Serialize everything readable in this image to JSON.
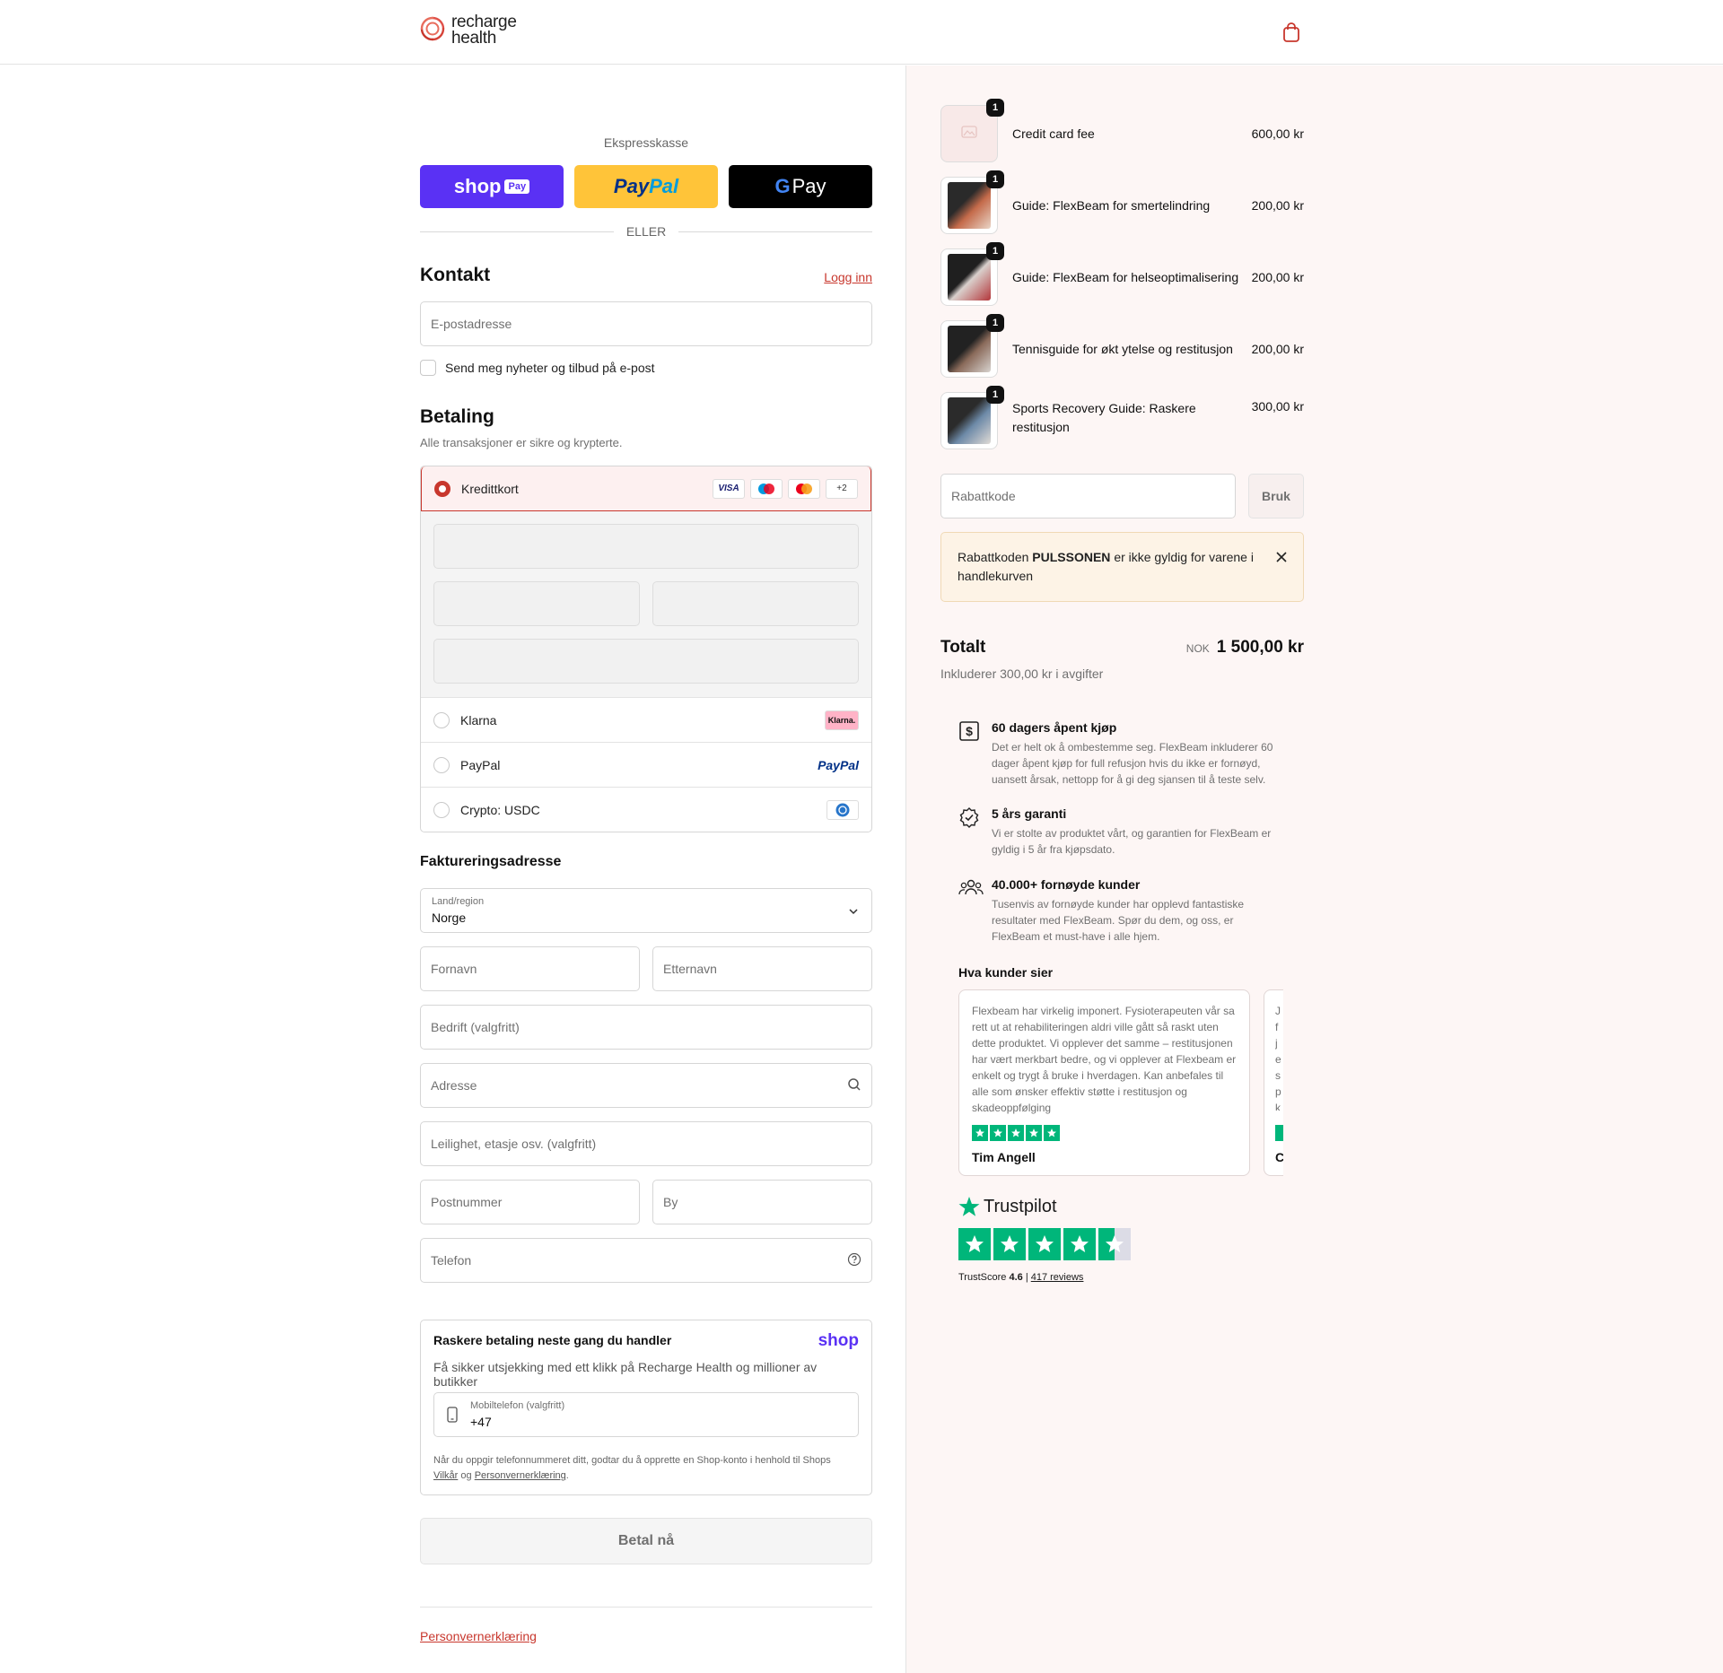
{
  "header": {
    "brand_line1": "recharge",
    "brand_line2": "health",
    "cart_icon": "bag-icon"
  },
  "express": {
    "title": "Ekspresskasse",
    "shop_label": "shop",
    "shop_badge": "Pay",
    "paypal_part1": "Pay",
    "paypal_part2": "Pal",
    "gpay_g": "G",
    "gpay_label": "Pay",
    "or_label": "ELLER"
  },
  "contact": {
    "title": "Kontakt",
    "login_link": "Logg inn",
    "email_placeholder": "E-postadresse",
    "newsletter_label": "Send meg nyheter og tilbud på e-post"
  },
  "payment": {
    "title": "Betaling",
    "subtitle": "Alle transaksjoner er sikre og krypterte.",
    "options": [
      {
        "label": "Kredittkort",
        "selected": true
      },
      {
        "label": "Klarna",
        "selected": false,
        "badge": "Klarna."
      },
      {
        "label": "PayPal",
        "selected": false,
        "badge": "PayPal"
      },
      {
        "label": "Crypto: USDC",
        "selected": false
      }
    ],
    "card_brands": [
      "VISA",
      "+2"
    ]
  },
  "billing": {
    "title": "Faktureringsadresse",
    "country_label": "Land/region",
    "country_value": "Norge",
    "first_name": "Fornavn",
    "last_name": "Etternavn",
    "company": "Bedrift (valgfritt)",
    "address": "Adresse",
    "apartment": "Leilighet, etasje osv. (valgfritt)",
    "postcode": "Postnummer",
    "city": "By",
    "phone": "Telefon"
  },
  "shop_pay": {
    "title": "Raskere betaling neste gang du handler",
    "logo": "shop",
    "subtitle": "Få sikker utsjekking med ett klikk på Recharge Health og millioner av butikker",
    "phone_label": "Mobiltelefon (valgfritt)",
    "phone_value": "+47",
    "legal_text": "Når du oppgir telefonnummeret ditt, godtar du å opprette en Shop-konto i henhold til Shops",
    "terms_link": "Vilkår",
    "and": "og",
    "privacy_link": "Personvernerklæring"
  },
  "pay_now": "Betal nå",
  "footer": {
    "privacy": "Personvernerklæring"
  },
  "order": {
    "items": [
      {
        "name": "Credit card fee",
        "price": "600,00 kr",
        "qty": "1"
      },
      {
        "name": "Guide: FlexBeam for smertelindring",
        "price": "200,00 kr",
        "qty": "1"
      },
      {
        "name": "Guide: FlexBeam for helseoptimalisering",
        "price": "200,00 kr",
        "qty": "1"
      },
      {
        "name": "Tennisguide for økt ytelse og restitusjon",
        "price": "200,00 kr",
        "qty": "1"
      },
      {
        "name": "Sports Recovery Guide: Raskere restitusjon",
        "price": "300,00 kr",
        "qty": "1"
      }
    ],
    "discount_placeholder": "Rabattkode",
    "apply_label": "Bruk",
    "alert_prefix": "Rabattkoden",
    "alert_code": "PULSSONEN",
    "alert_suffix": "er ikke gyldig for varene i handlekurven",
    "total_label": "Totalt",
    "currency": "NOK",
    "total_amount": "1 500,00 kr",
    "included": "Inkluderer 300,00 kr i avgifter"
  },
  "features": [
    {
      "icon": "dollar-box-icon",
      "title": "60 dagers åpent kjøp",
      "desc": "Det er helt ok å ombestemme seg. FlexBeam inkluderer 60 dager åpent kjøp for full refusjon hvis du ikke er fornøyd, uansett årsak, nettopp for å gi deg sjansen til å teste selv."
    },
    {
      "icon": "badge-check-icon",
      "title": "5 års garanti",
      "desc": "Vi er stolte av produktet vårt, og garantien for FlexBeam er gyldig i 5 år fra kjøpsdato."
    },
    {
      "icon": "users-icon",
      "title": "40.000+ fornøyde kunder",
      "desc": "Tusenvis av fornøyde kunder har opplevd fantastiske resultater med FlexBeam. Spør du dem, og oss, er FlexBeam et must-have i alle hjem."
    }
  ],
  "reviews": {
    "title": "Hva kunder sier",
    "items": [
      {
        "text": "Flexbeam har virkelig imponert. Fysioterapeuten vår sa rett ut at rehabiliteringen aldri ville gått så raskt uten dette produktet. Vi opplever det samme – restitusjonen har vært merkbart bedre, og vi opplever at Flexbeam er enkelt og trygt å bruke i hverdagen. Kan anbefales til alle som ønsker effektiv støtte i restitusjon og skadeoppfølging",
        "rating": 5,
        "name": "Tim Angell"
      },
      {
        "text": "J f je s p k",
        "rating": 5,
        "name": "C"
      }
    ]
  },
  "trustpilot": {
    "name": "Trustpilot",
    "score_label": "TrustScore",
    "score": "4.6",
    "separator": "|",
    "reviews_link": "417 reviews",
    "rating": 4.6
  },
  "colors": {
    "accent": "#c8372d",
    "shop_purple": "#5a31f4",
    "paypal_yellow": "#ffc439",
    "trustpilot_green": "#00b67a",
    "summary_bg": "#fdf6f5"
  }
}
